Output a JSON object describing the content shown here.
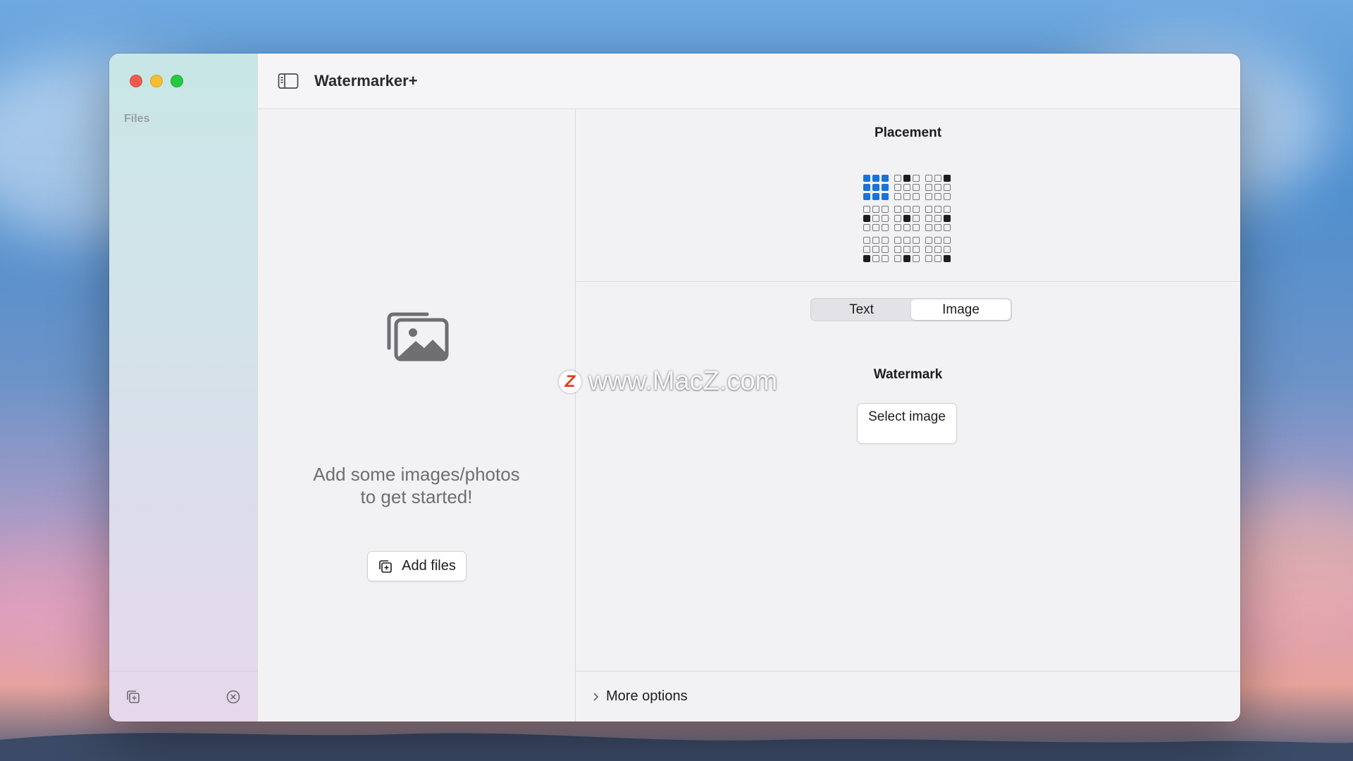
{
  "window": {
    "title": "Watermarker+"
  },
  "sidebar": {
    "heading": "Files",
    "footer": {
      "add_icon": "add-files-icon",
      "remove_icon": "remove-circle-icon"
    }
  },
  "drop_area": {
    "icon": "photos-stack-icon",
    "message_line1": "Add some images/photos",
    "message_line2": "to get started!",
    "add_files_label": "Add files"
  },
  "placement": {
    "title": "Placement",
    "selected_position": "top-left"
  },
  "mode_selector": {
    "options": [
      "Text",
      "Image"
    ],
    "selected": "Image"
  },
  "watermark": {
    "title": "Watermark",
    "select_image_label": "Select image"
  },
  "more_options": {
    "label": "More options"
  },
  "overlay": {
    "badge_letter": "Z",
    "text": "www.MacZ.com"
  },
  "colors": {
    "accent": "#1a73d8",
    "close": "#ee5a52",
    "minimize": "#f5bd2f",
    "zoom": "#28c840"
  }
}
